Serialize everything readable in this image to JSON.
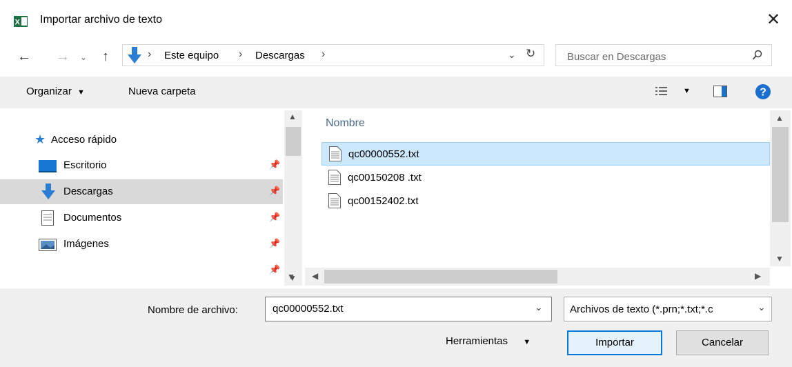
{
  "window": {
    "title": "Importar archivo de texto"
  },
  "nav": {
    "breadcrumb": [
      "Este equipo",
      "Descargas"
    ],
    "search_placeholder": "Buscar en Descargas"
  },
  "toolbar": {
    "organize": "Organizar",
    "new_folder": "Nueva carpeta"
  },
  "sidebar": {
    "quick_access": "Acceso rápido",
    "items": [
      {
        "label": "Escritorio"
      },
      {
        "label": "Descargas"
      },
      {
        "label": "Documentos"
      },
      {
        "label": "Imágenes"
      }
    ]
  },
  "files": {
    "column": "Nombre",
    "items": [
      "qc00000552.txt",
      "qc00150208 .txt",
      "qc00152402.txt"
    ]
  },
  "footer": {
    "filename_label": "Nombre de archivo:",
    "filename_value": "qc00000552.txt",
    "filetype": "Archivos de texto (*.prn;*.txt;*.c",
    "tools": "Herramientas",
    "import": "Importar",
    "cancel": "Cancelar"
  },
  "colors": {
    "accent": "#0078d7",
    "selection": "#cce8ff",
    "toolbar_bg": "#f0f0f0"
  }
}
